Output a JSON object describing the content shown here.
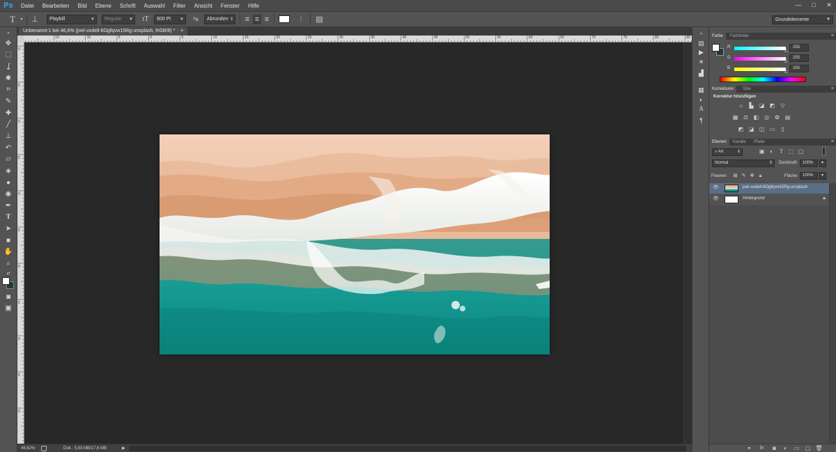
{
  "app": {
    "logo": "Ps"
  },
  "menu": [
    "Datei",
    "Bearbeiten",
    "Bild",
    "Ebene",
    "Schrift",
    "Auswahl",
    "Filter",
    "Ansicht",
    "Fenster",
    "Hilfe"
  ],
  "window_controls": {
    "minimize": "—",
    "maximize": "□",
    "close": "✕"
  },
  "options_bar": {
    "font_family": "Playbill",
    "font_style": "Regular",
    "font_size": "800 Pt",
    "aa_label": "ªa",
    "antialias": "Abrunden"
  },
  "workspace": "Grundelemente",
  "document": {
    "tab_title": "Unbenannt-1 bei 46,6% (joel-vodell-8Ogfqvw15Rg-unsplash, RGB/8) *",
    "close": "×"
  },
  "rulers": {
    "top_ticks": [
      "20",
      "15",
      "10",
      "5",
      "0",
      "5",
      "10",
      "15",
      "20",
      "25",
      "30",
      "35",
      "40",
      "45",
      "50",
      "55",
      "60",
      "65",
      "70",
      "75",
      "80",
      "85",
      "90"
    ],
    "left_ticks": [
      "0",
      "5",
      "0",
      "5",
      "0",
      "5",
      "0",
      "5",
      "0",
      "5",
      "0"
    ]
  },
  "status": {
    "zoom": "46,62%",
    "doc_info": "Dok.: 5,93 MB/17,6 MB",
    "arrow": "▶"
  },
  "color_panel": {
    "tabs": [
      "Farbe",
      "Farbfelder"
    ],
    "channels": [
      {
        "label": "R",
        "value": "255"
      },
      {
        "label": "G",
        "value": "255"
      },
      {
        "label": "B",
        "value": "255"
      }
    ]
  },
  "adjustments_panel": {
    "tabs": [
      "Korrekturen",
      "Stile"
    ],
    "heading": "Korrektur hinzufügen"
  },
  "layers_panel": {
    "tabs": [
      "Ebenen",
      "Kanäle",
      "Pfade"
    ],
    "filter": "Art",
    "blend_mode": "Normal",
    "opacity_label": "Deckkraft:",
    "opacity": "100%",
    "lock_label": "Fixieren:",
    "fill_label": "Fläche:",
    "fill": "100%",
    "layers": [
      {
        "name": "joel-vodell-8Ogfqvw15Rg-unsplash",
        "selected": true
      },
      {
        "name": "Hintergrund",
        "selected": false
      }
    ],
    "footer_icons": [
      "link-icon",
      "fx-icon",
      "mask-icon",
      "adjustment-icon",
      "group-icon",
      "new-layer-icon",
      "trash-icon"
    ]
  },
  "colors": {
    "accent_blue": "#31a8ff",
    "foreground": "#ffffff",
    "background": "#1e3c3c",
    "selected_layer": "#5a6e86"
  }
}
